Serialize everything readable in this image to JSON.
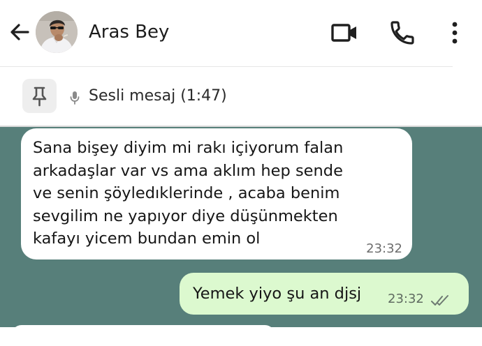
{
  "header": {
    "contact_name": "Aras Bey",
    "back_icon": "arrow-left-icon",
    "video_icon": "video-camera-icon",
    "call_icon": "phone-icon",
    "menu_icon": "more-vertical-icon"
  },
  "pinned": {
    "pin_icon": "pin-icon",
    "mic_icon": "microphone-icon",
    "label": "Sesli mesaj (1:47)"
  },
  "messages": [
    {
      "direction": "incoming",
      "text": "Sana bişey diyim mi rakı içiyorum falan\narkadaşlar var vs ama aklım hep sende\nve senin şöyledıklerinde , acaba benim\nsevgilim ne yapıyor diye düşünmekten\nkafayı yicem bundan emin ol",
      "time": "23:32"
    },
    {
      "direction": "outgoing",
      "text": "Yemek yiyo şu an djsj",
      "time": "23:32",
      "status": "read",
      "status_icon": "double-check-icon"
    }
  ],
  "colors": {
    "chat_background": "#577f7a",
    "incoming_bubble": "#ffffff",
    "outgoing_bubble": "#dcf9cf",
    "header_background": "#ffffff"
  }
}
